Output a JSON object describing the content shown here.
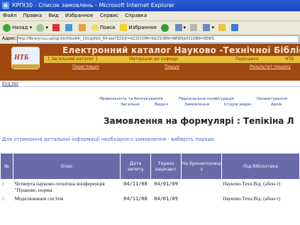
{
  "window": {
    "title": "КРПІ30 - Список замовлень - Microsoft Internet Explorer"
  },
  "menu": {
    "items": [
      "Файл",
      "Правка",
      "Вид",
      "Избранное",
      "Сервис",
      "Справка"
    ]
  },
  "toolbar": {
    "back_label": "Назад",
    "search_label": "Поиск",
    "favorites_label": "Избранное"
  },
  "address": {
    "label": "Адрес:",
    "url": "http://library.nuu.ua/cgi-bin/irbis64r_13/cgiirbis_64.exe?Z21ID=&C21COM=S&I21DBN=NEWS&P21DBN=NEWS"
  },
  "banner": {
    "title": "Електронний каталог Науково -Технічної Бібліот",
    "logo_text": "НТБ",
    "gold_links": [
      "[ Загальний каталог ]",
      "Матеріали до кафедр",
      "Періодика",
      "НТБ"
    ],
    "sub_links": [
      "Переглядач",
      "Пошук",
      "Результат пошуку"
    ]
  },
  "eng_version": "Eng Ver",
  "navlinks": {
    "row1": [
      "Правильність та безпекування",
      "Персональна конфігурація",
      "Налаштування"
    ],
    "row2": [
      "Загальне",
      "Видачі",
      "Замовлення",
      "Історія видач",
      "Архів"
    ]
  },
  "page_title": "Замовлення на формулярі : Тепікіна Л",
  "info_text": "Для отримання детальної інформації необхідного замовлення - виберіть порядо",
  "table": {
    "headers": [
      "№",
      "Опис",
      "Дата запиту",
      "Термін зацікавл.",
      "На бронюполиці з",
      "Під-бібліотека"
    ],
    "rows": [
      {
        "num": "1",
        "desc": "Четверта науково-технічна конференція \"Правове, норма",
        "date_request": "04/11/08",
        "date_interest": "04/01/09",
        "reserved": "",
        "lib": "Науково-Техн.Від. (абон-т)"
      },
      {
        "num": "2",
        "desc": "Моделювання систем",
        "date_request": "04/11/08",
        "date_interest": "04/01/09",
        "reserved": "",
        "lib": "Науково-Техн.Від. (абон-т)"
      }
    ]
  },
  "colors": {
    "banner_bg": "#a04810",
    "gold_bar": "#e8be3a",
    "table_header": "#6a6aa8",
    "link_blue": "#3a6ad0"
  }
}
